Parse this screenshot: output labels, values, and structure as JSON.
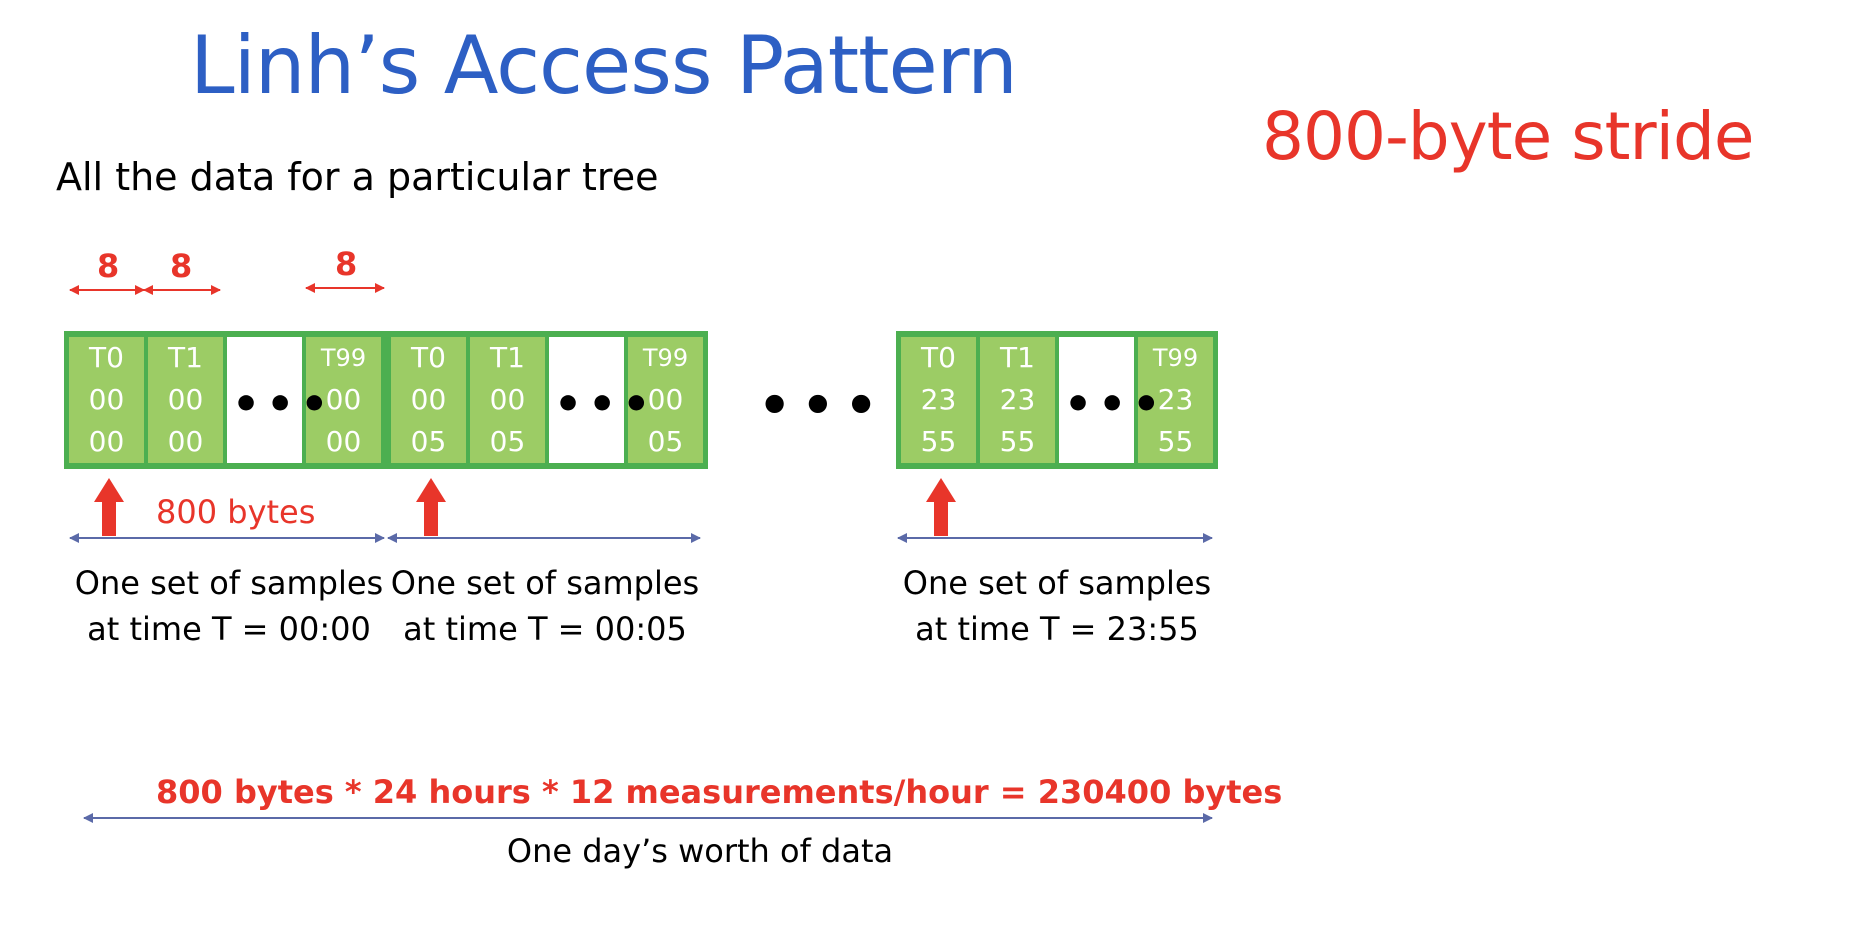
{
  "colors": {
    "title": "#2d5fc4",
    "accent": "#e8352a",
    "cell_fill": "#9ccc65",
    "group_fill": "#4caf50",
    "arrow_line": "#5b6aa8"
  },
  "title": "Linh’s Access Pattern",
  "headline": "800-byte stride",
  "subtitle": "All the data for a particular tree",
  "byte_widths": [
    "8",
    "8",
    "8"
  ],
  "ellipsis": "•••",
  "groups": [
    {
      "cells": [
        {
          "t": "T0",
          "h": "00",
          "m": "00"
        },
        {
          "t": "T1",
          "h": "00",
          "m": "00"
        },
        {
          "t": "T99",
          "h": "00",
          "m": "00"
        }
      ],
      "caption_line1": "One set of samples",
      "caption_line2": "at time T = 00:00"
    },
    {
      "cells": [
        {
          "t": "T0",
          "h": "00",
          "m": "05"
        },
        {
          "t": "T1",
          "h": "00",
          "m": "05"
        },
        {
          "t": "T99",
          "h": "00",
          "m": "05"
        }
      ],
      "caption_line1": "One set of samples",
      "caption_line2": "at time T = 00:05"
    },
    {
      "cells": [
        {
          "t": "T0",
          "h": "23",
          "m": "55"
        },
        {
          "t": "T1",
          "h": "23",
          "m": "55"
        },
        {
          "t": "T99",
          "h": "23",
          "m": "55"
        }
      ],
      "caption_line1": "One set of samples",
      "caption_line2": "at time T = 23:55"
    }
  ],
  "stride_label": "800 bytes",
  "formula": "800 bytes * 24 hours * 12 measurements/hour = 230400 bytes",
  "day_caption": "One day’s worth of data"
}
